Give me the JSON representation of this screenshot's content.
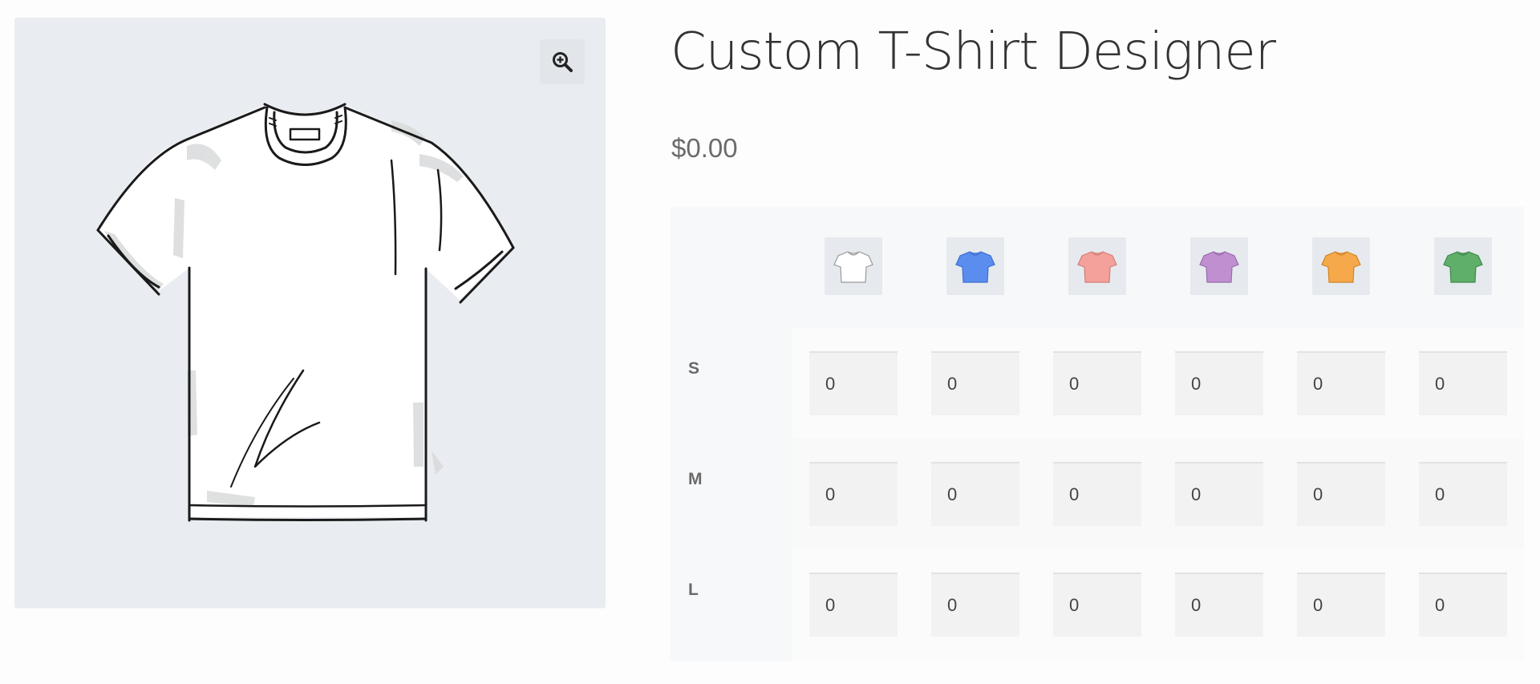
{
  "product": {
    "title": "Custom T-Shirt Designer",
    "price": "$0.00"
  },
  "gallery": {
    "zoom_icon": "zoom-in-icon",
    "image": "white-t-shirt-sketch"
  },
  "variations": {
    "colors": [
      {
        "name": "white",
        "hex": "#ffffff"
      },
      {
        "name": "blue",
        "hex": "#5b8def"
      },
      {
        "name": "pink",
        "hex": "#f4a09b"
      },
      {
        "name": "purple",
        "hex": "#c08fd0"
      },
      {
        "name": "orange",
        "hex": "#f6a94b"
      },
      {
        "name": "green",
        "hex": "#5fae6a"
      }
    ],
    "sizes": [
      {
        "label": "S",
        "quantities": [
          "0",
          "0",
          "0",
          "0",
          "0",
          "0"
        ]
      },
      {
        "label": "M",
        "quantities": [
          "0",
          "0",
          "0",
          "0",
          "0",
          "0"
        ]
      },
      {
        "label": "L",
        "quantities": [
          "0",
          "0",
          "0",
          "0",
          "0",
          "0"
        ]
      }
    ]
  }
}
